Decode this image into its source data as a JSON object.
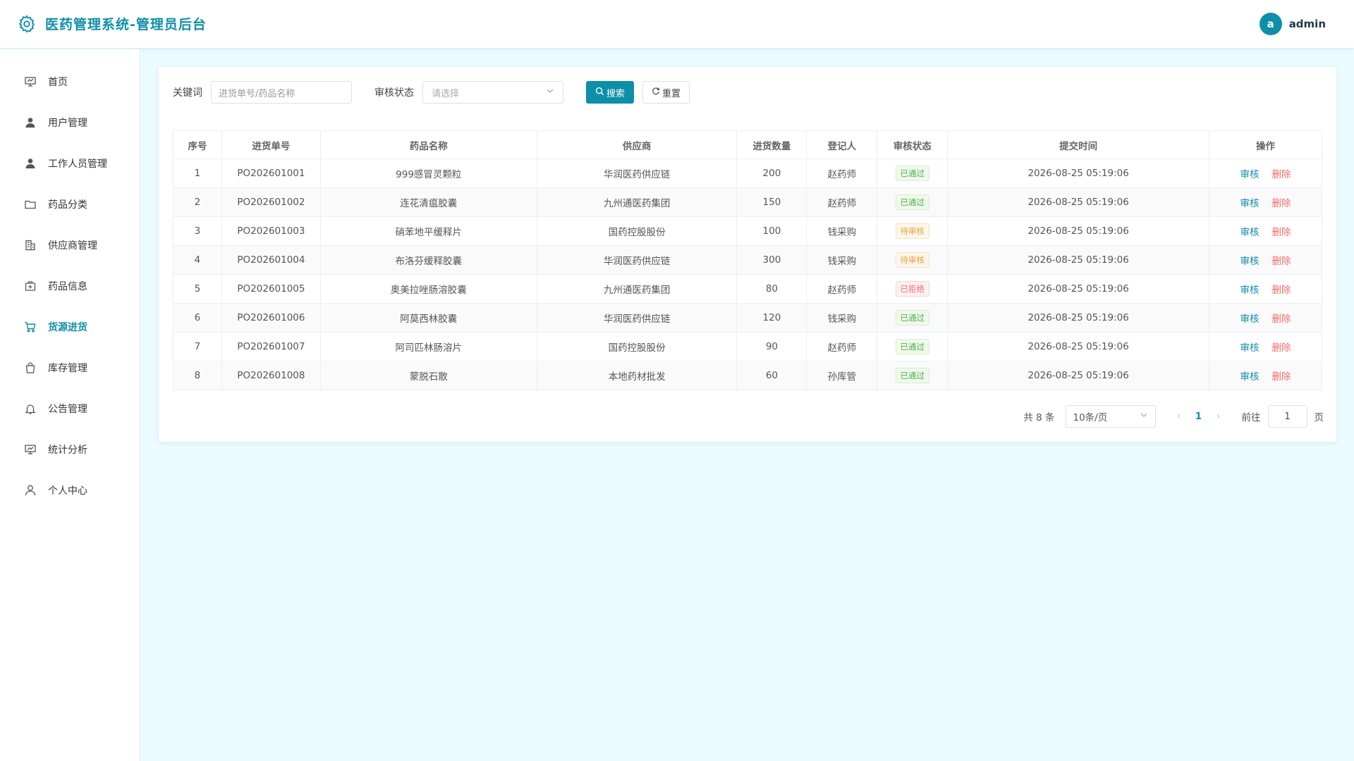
{
  "header": {
    "title": "医药管理系统-管理员后台",
    "avatar_letter": "a",
    "username": "admin"
  },
  "sidebar": {
    "items": [
      {
        "label": "首页",
        "icon": "dashboard-icon"
      },
      {
        "label": "用户管理",
        "icon": "user-icon"
      },
      {
        "label": "工作人员管理",
        "icon": "user-icon"
      },
      {
        "label": "药品分类",
        "icon": "folder-icon"
      },
      {
        "label": "供应商管理",
        "icon": "building-icon"
      },
      {
        "label": "药品信息",
        "icon": "medicine-box-icon"
      },
      {
        "label": "货源进货",
        "icon": "cart-icon",
        "active": true
      },
      {
        "label": "库存管理",
        "icon": "bag-icon"
      },
      {
        "label": "公告管理",
        "icon": "bell-icon"
      },
      {
        "label": "统计分析",
        "icon": "chart-board-icon"
      },
      {
        "label": "个人中心",
        "icon": "person-icon"
      }
    ]
  },
  "filter": {
    "keyword_label": "关键词",
    "keyword_placeholder": "进货单号/药品名称",
    "status_label": "审核状态",
    "status_placeholder": "请选择",
    "search_label": "搜索",
    "reset_label": "重置"
  },
  "table": {
    "headers": [
      "序号",
      "进货单号",
      "药品名称",
      "供应商",
      "进货数量",
      "登记人",
      "审核状态",
      "提交时间",
      "操作"
    ],
    "rows": [
      {
        "no": "1",
        "order": "PO202601001",
        "drug": "999感冒灵颗粒",
        "supplier": "华润医药供应链",
        "qty": "200",
        "registrar": "赵药师",
        "status": "已通过",
        "status_type": "pass",
        "time": "2026-08-25 05:19:06"
      },
      {
        "no": "2",
        "order": "PO202601002",
        "drug": "连花清瘟胶囊",
        "supplier": "九州通医药集团",
        "qty": "150",
        "registrar": "赵药师",
        "status": "已通过",
        "status_type": "pass",
        "time": "2026-08-25 05:19:06"
      },
      {
        "no": "3",
        "order": "PO202601003",
        "drug": "硝苯地平缓释片",
        "supplier": "国药控股股份",
        "qty": "100",
        "registrar": "钱采购",
        "status": "待审核",
        "status_type": "wait",
        "time": "2026-08-25 05:19:06"
      },
      {
        "no": "4",
        "order": "PO202601004",
        "drug": "布洛芬缓释胶囊",
        "supplier": "华润医药供应链",
        "qty": "300",
        "registrar": "钱采购",
        "status": "待审核",
        "status_type": "wait",
        "time": "2026-08-25 05:19:06"
      },
      {
        "no": "5",
        "order": "PO202601005",
        "drug": "奥美拉唑肠溶胶囊",
        "supplier": "九州通医药集团",
        "qty": "80",
        "registrar": "赵药师",
        "status": "已拒绝",
        "status_type": "reject",
        "time": "2026-08-25 05:19:06"
      },
      {
        "no": "6",
        "order": "PO202601006",
        "drug": "阿莫西林胶囊",
        "supplier": "华润医药供应链",
        "qty": "120",
        "registrar": "钱采购",
        "status": "已通过",
        "status_type": "pass",
        "time": "2026-08-25 05:19:06"
      },
      {
        "no": "7",
        "order": "PO202601007",
        "drug": "阿司匹林肠溶片",
        "supplier": "国药控股股份",
        "qty": "90",
        "registrar": "赵药师",
        "status": "已通过",
        "status_type": "pass",
        "time": "2026-08-25 05:19:06"
      },
      {
        "no": "8",
        "order": "PO202601008",
        "drug": "蒙脱石散",
        "supplier": "本地药材批发",
        "qty": "60",
        "registrar": "孙库管",
        "status": "已通过",
        "status_type": "pass",
        "time": "2026-08-25 05:19:06"
      }
    ],
    "audit_label": "审核",
    "delete_label": "删除"
  },
  "pagination": {
    "total": "共 8 条",
    "page_size": "10条/页",
    "current_page": "1",
    "goto_label": "前往",
    "goto_value": "1",
    "page_suffix": "页"
  },
  "colors": {
    "accent": "#0e8fa8",
    "pass": "#4caf50",
    "wait": "#e6a23c",
    "reject": "#f56c6c",
    "background": "#eafcff"
  }
}
